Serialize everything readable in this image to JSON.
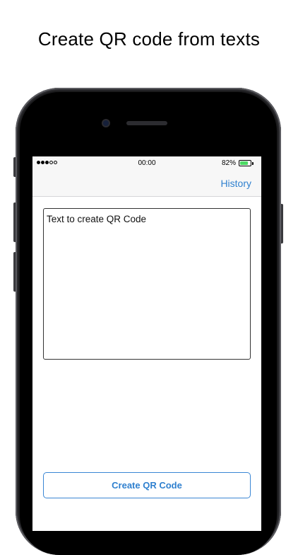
{
  "headline": "Create QR code from texts",
  "status_bar": {
    "signal_dots": [
      true,
      true,
      true,
      false,
      false
    ],
    "time": "00:00",
    "battery_percent": "82%",
    "battery_level": 0.82,
    "battery_color": "#4cd964"
  },
  "nav": {
    "history_label": "History"
  },
  "editor": {
    "value": "Text to create QR Code"
  },
  "actions": {
    "create_label": "Create QR Code"
  },
  "colors": {
    "accent": "#2f80cf",
    "phone_body": "#1b1b1d"
  }
}
